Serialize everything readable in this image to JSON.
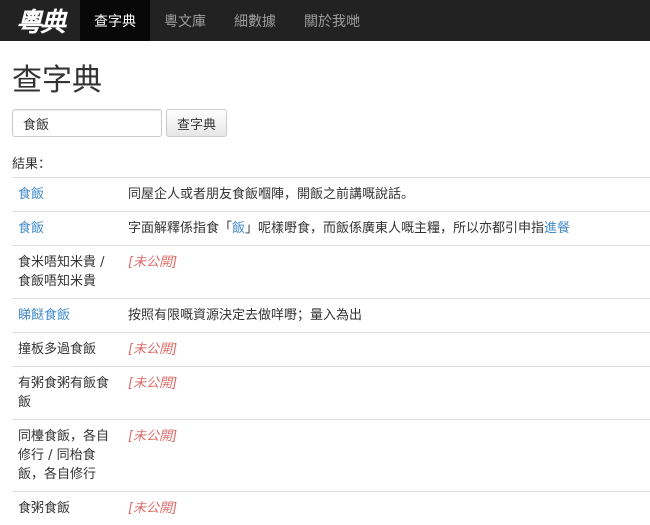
{
  "nav": {
    "brand": "粵典",
    "items": [
      {
        "label": "查字典",
        "active": true
      },
      {
        "label": "粵文庫",
        "active": false
      },
      {
        "label": "細數據",
        "active": false
      },
      {
        "label": "關於我哋",
        "active": false
      }
    ]
  },
  "page_title": "查字典",
  "search": {
    "value": "食飯",
    "placeholder": "",
    "button_label": "查字典"
  },
  "results_label": "結果：",
  "results": [
    {
      "term": "食飯",
      "term_link": true,
      "def_parts": [
        {
          "text": "同屋企人或者朋友食飯嗰陣，開飯之前講嘅說話。"
        }
      ]
    },
    {
      "term": "食飯",
      "term_link": true,
      "def_parts": [
        {
          "text": "字面解釋係指食「"
        },
        {
          "text": "飯",
          "link": true
        },
        {
          "text": "」呢樣嘢食，而飯係廣東人嘅主糧，所以亦都引申指"
        },
        {
          "text": "進餐",
          "link": true
        }
      ]
    },
    {
      "term": "食米唔知米貴 / 食飯唔知米貴",
      "term_link": false,
      "unpublished": "[未公開]"
    },
    {
      "term": "睇餸食飯",
      "term_link": true,
      "def_parts": [
        {
          "text": "按照有限嘅資源決定去做咩嘢；量入為出"
        }
      ]
    },
    {
      "term": "撞板多過食飯",
      "term_link": false,
      "unpublished": "[未公開]"
    },
    {
      "term": "有粥食粥有飯食飯",
      "term_link": false,
      "unpublished": "[未公開]"
    },
    {
      "term": "同檯食飯，各自修行 / 同枱食飯，各自修行",
      "term_link": false,
      "unpublished": "[未公開]"
    },
    {
      "term": "食粥食飯",
      "term_link": false,
      "unpublished": "[未公開]"
    }
  ],
  "colors": {
    "navbar_bg": "#222222",
    "link": "#428bca",
    "unpublished": "#d9534f"
  }
}
